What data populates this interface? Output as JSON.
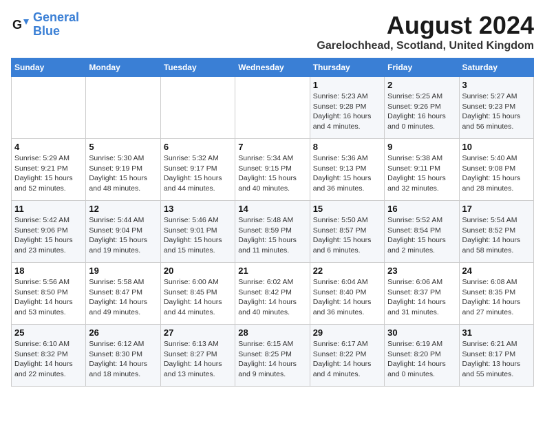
{
  "header": {
    "logo_line1": "General",
    "logo_line2": "Blue",
    "month_year": "August 2024",
    "location": "Garelochhead, Scotland, United Kingdom"
  },
  "days_of_week": [
    "Sunday",
    "Monday",
    "Tuesday",
    "Wednesday",
    "Thursday",
    "Friday",
    "Saturday"
  ],
  "weeks": [
    [
      {
        "day": "",
        "info": ""
      },
      {
        "day": "",
        "info": ""
      },
      {
        "day": "",
        "info": ""
      },
      {
        "day": "",
        "info": ""
      },
      {
        "day": "1",
        "info": "Sunrise: 5:23 AM\nSunset: 9:28 PM\nDaylight: 16 hours\nand 4 minutes."
      },
      {
        "day": "2",
        "info": "Sunrise: 5:25 AM\nSunset: 9:26 PM\nDaylight: 16 hours\nand 0 minutes."
      },
      {
        "day": "3",
        "info": "Sunrise: 5:27 AM\nSunset: 9:23 PM\nDaylight: 15 hours\nand 56 minutes."
      }
    ],
    [
      {
        "day": "4",
        "info": "Sunrise: 5:29 AM\nSunset: 9:21 PM\nDaylight: 15 hours\nand 52 minutes."
      },
      {
        "day": "5",
        "info": "Sunrise: 5:30 AM\nSunset: 9:19 PM\nDaylight: 15 hours\nand 48 minutes."
      },
      {
        "day": "6",
        "info": "Sunrise: 5:32 AM\nSunset: 9:17 PM\nDaylight: 15 hours\nand 44 minutes."
      },
      {
        "day": "7",
        "info": "Sunrise: 5:34 AM\nSunset: 9:15 PM\nDaylight: 15 hours\nand 40 minutes."
      },
      {
        "day": "8",
        "info": "Sunrise: 5:36 AM\nSunset: 9:13 PM\nDaylight: 15 hours\nand 36 minutes."
      },
      {
        "day": "9",
        "info": "Sunrise: 5:38 AM\nSunset: 9:11 PM\nDaylight: 15 hours\nand 32 minutes."
      },
      {
        "day": "10",
        "info": "Sunrise: 5:40 AM\nSunset: 9:08 PM\nDaylight: 15 hours\nand 28 minutes."
      }
    ],
    [
      {
        "day": "11",
        "info": "Sunrise: 5:42 AM\nSunset: 9:06 PM\nDaylight: 15 hours\nand 23 minutes."
      },
      {
        "day": "12",
        "info": "Sunrise: 5:44 AM\nSunset: 9:04 PM\nDaylight: 15 hours\nand 19 minutes."
      },
      {
        "day": "13",
        "info": "Sunrise: 5:46 AM\nSunset: 9:01 PM\nDaylight: 15 hours\nand 15 minutes."
      },
      {
        "day": "14",
        "info": "Sunrise: 5:48 AM\nSunset: 8:59 PM\nDaylight: 15 hours\nand 11 minutes."
      },
      {
        "day": "15",
        "info": "Sunrise: 5:50 AM\nSunset: 8:57 PM\nDaylight: 15 hours\nand 6 minutes."
      },
      {
        "day": "16",
        "info": "Sunrise: 5:52 AM\nSunset: 8:54 PM\nDaylight: 15 hours\nand 2 minutes."
      },
      {
        "day": "17",
        "info": "Sunrise: 5:54 AM\nSunset: 8:52 PM\nDaylight: 14 hours\nand 58 minutes."
      }
    ],
    [
      {
        "day": "18",
        "info": "Sunrise: 5:56 AM\nSunset: 8:50 PM\nDaylight: 14 hours\nand 53 minutes."
      },
      {
        "day": "19",
        "info": "Sunrise: 5:58 AM\nSunset: 8:47 PM\nDaylight: 14 hours\nand 49 minutes."
      },
      {
        "day": "20",
        "info": "Sunrise: 6:00 AM\nSunset: 8:45 PM\nDaylight: 14 hours\nand 44 minutes."
      },
      {
        "day": "21",
        "info": "Sunrise: 6:02 AM\nSunset: 8:42 PM\nDaylight: 14 hours\nand 40 minutes."
      },
      {
        "day": "22",
        "info": "Sunrise: 6:04 AM\nSunset: 8:40 PM\nDaylight: 14 hours\nand 36 minutes."
      },
      {
        "day": "23",
        "info": "Sunrise: 6:06 AM\nSunset: 8:37 PM\nDaylight: 14 hours\nand 31 minutes."
      },
      {
        "day": "24",
        "info": "Sunrise: 6:08 AM\nSunset: 8:35 PM\nDaylight: 14 hours\nand 27 minutes."
      }
    ],
    [
      {
        "day": "25",
        "info": "Sunrise: 6:10 AM\nSunset: 8:32 PM\nDaylight: 14 hours\nand 22 minutes."
      },
      {
        "day": "26",
        "info": "Sunrise: 6:12 AM\nSunset: 8:30 PM\nDaylight: 14 hours\nand 18 minutes."
      },
      {
        "day": "27",
        "info": "Sunrise: 6:13 AM\nSunset: 8:27 PM\nDaylight: 14 hours\nand 13 minutes."
      },
      {
        "day": "28",
        "info": "Sunrise: 6:15 AM\nSunset: 8:25 PM\nDaylight: 14 hours\nand 9 minutes."
      },
      {
        "day": "29",
        "info": "Sunrise: 6:17 AM\nSunset: 8:22 PM\nDaylight: 14 hours\nand 4 minutes."
      },
      {
        "day": "30",
        "info": "Sunrise: 6:19 AM\nSunset: 8:20 PM\nDaylight: 14 hours\nand 0 minutes."
      },
      {
        "day": "31",
        "info": "Sunrise: 6:21 AM\nSunset: 8:17 PM\nDaylight: 13 hours\nand 55 minutes."
      }
    ]
  ]
}
